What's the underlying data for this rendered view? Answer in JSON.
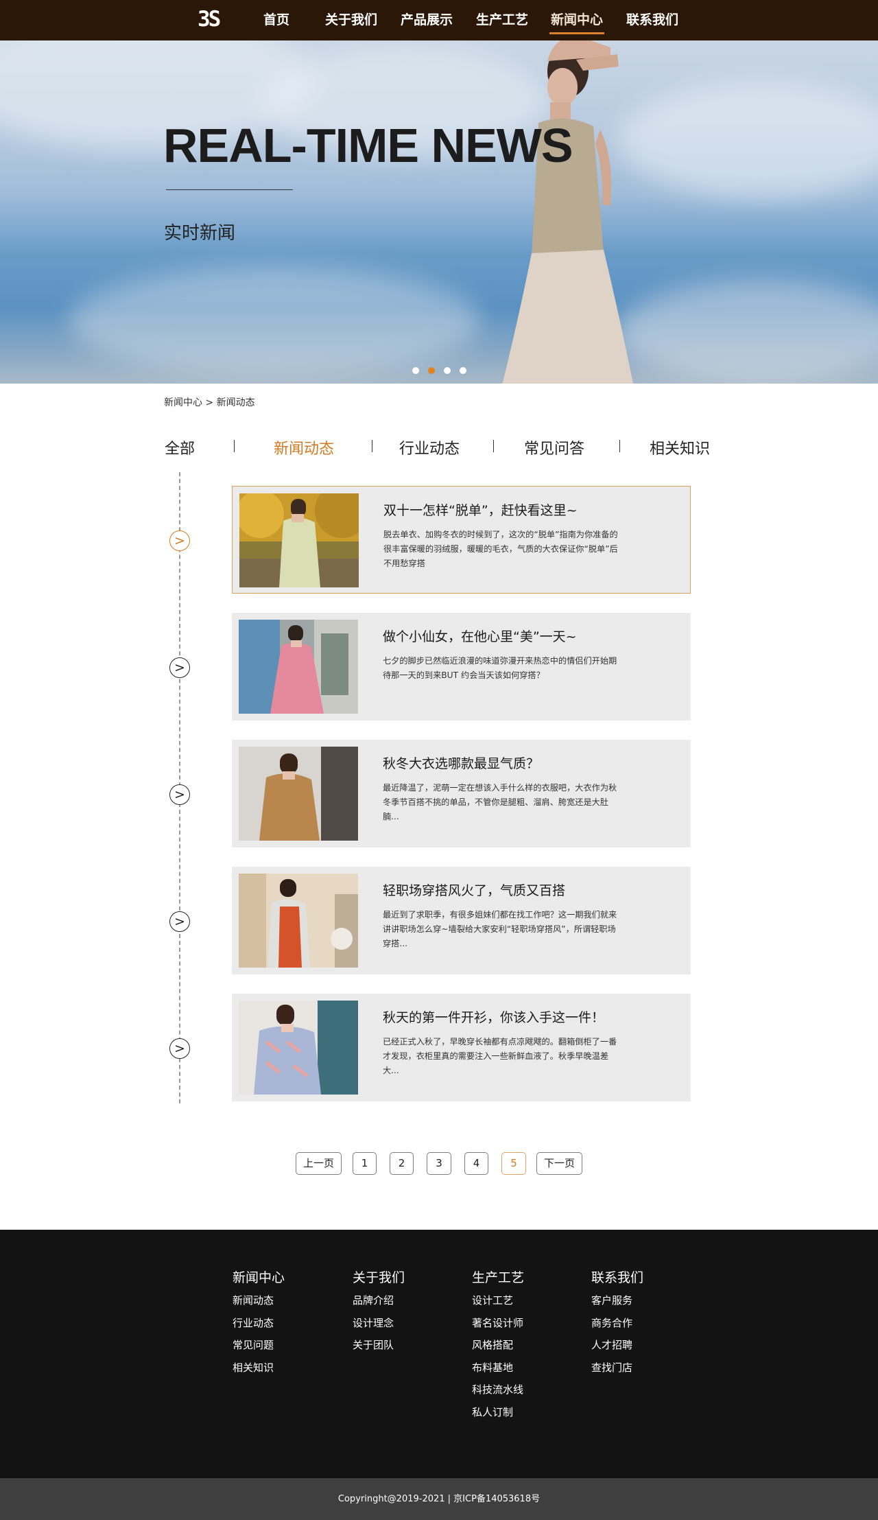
{
  "nav": {
    "logo": "3S",
    "items": [
      {
        "label": "首页"
      },
      {
        "label": "关于我们"
      },
      {
        "label": "产品展示"
      },
      {
        "label": "生产工艺"
      },
      {
        "label": "新闻中心",
        "active": true
      },
      {
        "label": "联系我们"
      }
    ],
    "colors": {
      "background": "#2b1708",
      "accent": "#d9822b"
    }
  },
  "hero": {
    "title": "REAL-TIME NEWS",
    "subtitle": "实时新闻",
    "carousel": {
      "count": 4,
      "active_index": 1
    }
  },
  "breadcrumb": "新闻中心 > 新闻动态",
  "tabs": [
    {
      "label": "全部"
    },
    {
      "label": "新闻动态",
      "active": true
    },
    {
      "label": "行业动态"
    },
    {
      "label": "常见问答"
    },
    {
      "label": "相关知识"
    }
  ],
  "news": [
    {
      "title": "双十一怎样“脱单”，赶快看这里~",
      "desc": "脱去单衣、加购冬衣的时候到了，这次的“脱单”指南为你准备的很丰富保暖的羽绒服，暖暖的毛衣，气质的大衣保证你“脱单”后不用愁穿搭",
      "active": true,
      "icon": "chevron-right-icon"
    },
    {
      "title": "做个小仙女，在他心里“美”一天~",
      "desc": "七夕的脚步已然临近浪漫的味道弥漫开来热恋中的情侣们开始期待那一天的到来BUT 约会当天该如何穿搭？",
      "icon": "chevron-right-icon"
    },
    {
      "title": "秋冬大衣选哪款最显气质？",
      "desc": "最近降温了，泥萌一定在想该入手什么样的衣服吧，大衣作为秋冬季节百搭不挑的单品，不管你是腿粗、溜肩、胯宽还是大肚腩...",
      "icon": "chevron-right-icon"
    },
    {
      "title": "轻职场穿搭风火了，气质又百搭",
      "desc": "最近到了求职季，有很多姐妹们都在找工作吧？这一期我们就来讲讲职场怎么穿~墙裂给大家安利“轻职场穿搭风”，所谓轻职场穿搭...",
      "icon": "chevron-right-icon"
    },
    {
      "title": "秋天的第一件开衫，你该入手这一件！",
      "desc": "已经正式入秋了，早晚穿长袖都有点凉飕飕的。翻箱倒柜了一番才发现，衣柜里真的需要注入一些新鲜血液了。秋季早晚温差大...",
      "icon": "chevron-right-icon"
    }
  ],
  "pagination": {
    "prev": "上一页",
    "next": "下一页",
    "pages": [
      "1",
      "2",
      "3",
      "4",
      "5"
    ],
    "current": "5"
  },
  "footer": {
    "columns": [
      {
        "title": "新闻中心",
        "links": [
          "新闻动态",
          "行业动态",
          "常见问题",
          "相关知识"
        ]
      },
      {
        "title": "关于我们",
        "links": [
          "品牌介绍",
          "设计理念",
          "关于团队"
        ]
      },
      {
        "title": "生产工艺",
        "links": [
          "设计工艺",
          "著名设计师",
          "风格搭配",
          "布料基地",
          "科技流水线",
          "私人订制"
        ]
      },
      {
        "title": "联系我们",
        "links": [
          "客户服务",
          "商务合作",
          "人才招聘",
          "查找门店"
        ]
      }
    ],
    "copyright": "Copyringht@2019-2021 | 京ICP备14053618号"
  }
}
